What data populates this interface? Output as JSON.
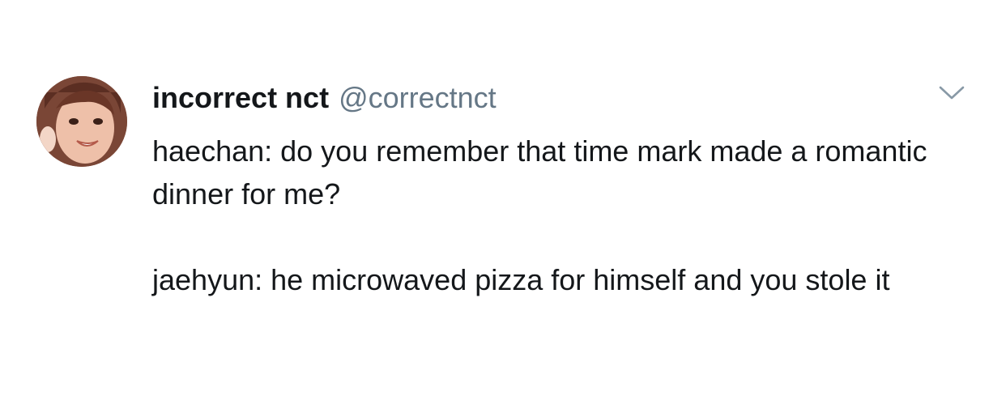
{
  "tweet": {
    "author": {
      "display_name": "incorrect nct",
      "handle": "@correctnct",
      "avatar": "profile-photo"
    },
    "menu_icon": "chevron-down-icon",
    "paragraphs": [
      "haechan: do you remember that time mark made a romantic dinner for me?",
      "jaehyun: he microwaved pizza for himself and you stole it"
    ]
  },
  "colors": {
    "text": "#14171a",
    "secondary": "#657786",
    "icon": "#8899a6",
    "background": "#ffffff"
  }
}
